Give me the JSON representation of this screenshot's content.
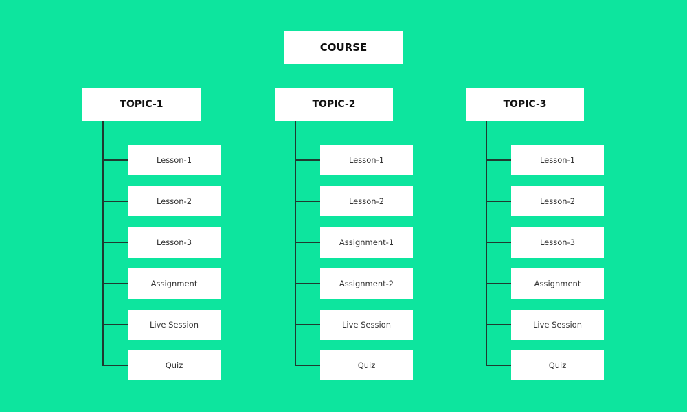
{
  "course": {
    "label": "COURSE"
  },
  "topics": [
    {
      "label": "TOPIC-1",
      "items": [
        "Lesson-1",
        "Lesson-2",
        "Lesson-3",
        "Assignment",
        "Live Session",
        "Quiz"
      ]
    },
    {
      "label": "TOPIC-2",
      "items": [
        "Lesson-1",
        "Lesson-2",
        "Assignment-1",
        "Assignment-2",
        "Live Session",
        "Quiz"
      ]
    },
    {
      "label": "TOPIC-3",
      "items": [
        "Lesson-1",
        "Lesson-2",
        "Lesson-3",
        "Assignment",
        "Live Session",
        "Quiz"
      ]
    }
  ],
  "colors": {
    "background": "#0de59e",
    "box": "#ffffff",
    "connector": "#1f3a30"
  }
}
